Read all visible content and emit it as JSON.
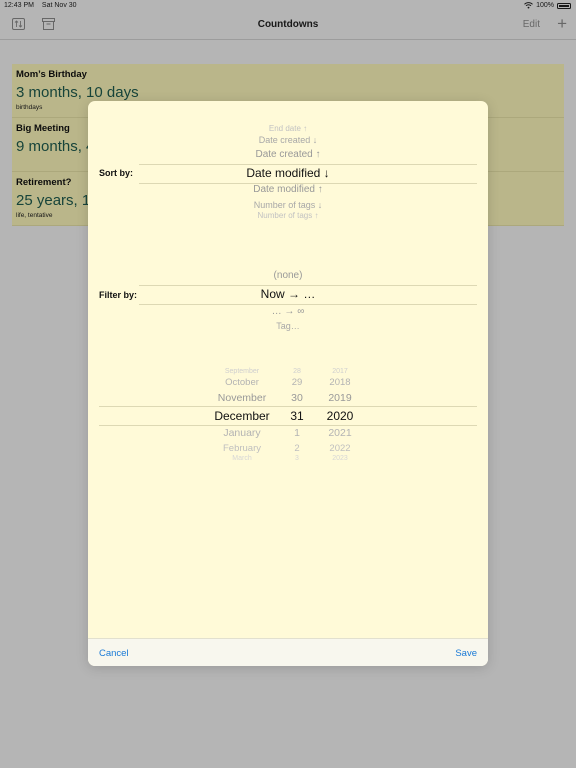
{
  "status": {
    "time": "12:43 PM",
    "date": "Sat Nov 30",
    "battery": "100%",
    "icons": [
      "wifi-icon",
      "battery-icon"
    ]
  },
  "nav": {
    "title": "Countdowns",
    "edit_label": "Edit",
    "plus_label": "+",
    "icons": [
      "sort-icon",
      "archive-icon"
    ]
  },
  "countdowns": [
    {
      "title": "Mom’s Birthday",
      "value": "3 months, 10 days",
      "tags": "birthdays"
    },
    {
      "title": "Big Meeting",
      "value": "9 months, 4",
      "tags": ""
    },
    {
      "title": "Retirement?",
      "value": "25 years, 1",
      "tags": "life, tentative"
    }
  ],
  "sheet": {
    "sort_label": "Sort by:",
    "sort_options": [
      "End date ↑",
      "Date created ↓",
      "Date created ↑",
      "Date modified ↓",
      "Date modified ↑",
      "Number of tags ↓",
      "Number of tags ↑"
    ],
    "sort_selected": "Date modified ↓",
    "filter_label": "Filter by:",
    "filter_options": [
      "(none)",
      "Now → …",
      "… → ∞",
      "Tag…"
    ],
    "filter_selected": "Now → …",
    "date_picker": {
      "months": [
        "September",
        "October",
        "November",
        "December",
        "January",
        "February",
        "March"
      ],
      "days": [
        "28",
        "29",
        "30",
        "31",
        "1",
        "2",
        "3"
      ],
      "years": [
        "2017",
        "2018",
        "2019",
        "2020",
        "2021",
        "2022",
        "2023"
      ],
      "selected": {
        "month": "December",
        "day": "31",
        "year": "2020"
      }
    },
    "cancel_label": "Cancel",
    "save_label": "Save"
  },
  "colors": {
    "accent": "#1a7ad6",
    "card_bg": "#f8f3b8",
    "sheet_bg": "#fffad8",
    "value_text": "#1f5b4e"
  }
}
